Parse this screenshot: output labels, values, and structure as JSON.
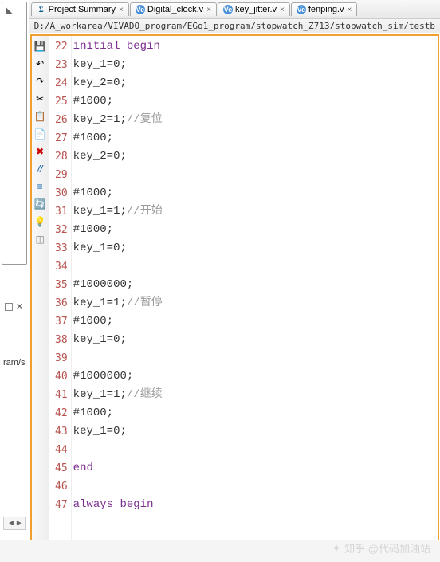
{
  "tabs": [
    {
      "icon": "Σ",
      "iconType": "sigma",
      "label": "Project Summary"
    },
    {
      "icon": "Ve",
      "iconType": "verilog",
      "label": "Digital_clock.v"
    },
    {
      "icon": "Ve",
      "iconType": "verilog",
      "label": "key_jitter.v"
    },
    {
      "icon": "Ve",
      "iconType": "verilog",
      "label": "fenping.v"
    }
  ],
  "filepath": "D:/A_workarea/VIVADO_program/EGo1_program/stopwatch_Z713/stopwatch_sim/testb",
  "left": {
    "truncText": "ram/s"
  },
  "code": {
    "start": 22,
    "lines": [
      {
        "t": "initial begin",
        "cls": "kw"
      },
      {
        "t": "key_1=0;"
      },
      {
        "t": "key_2=0;"
      },
      {
        "t": "#1000;"
      },
      {
        "t": "key_2=1;",
        "c": "//复位"
      },
      {
        "t": "#1000;"
      },
      {
        "t": "key_2=0;"
      },
      {
        "t": ""
      },
      {
        "t": "#1000;"
      },
      {
        "t": "key_1=1;",
        "c": "//开始"
      },
      {
        "t": "#1000;"
      },
      {
        "t": "key_1=0;"
      },
      {
        "t": ""
      },
      {
        "t": "#1000000;"
      },
      {
        "t": "key_1=1;",
        "c": "//暂停"
      },
      {
        "t": "#1000;"
      },
      {
        "t": "key_1=0;"
      },
      {
        "t": ""
      },
      {
        "t": "#1000000;"
      },
      {
        "t": "key_1=1;",
        "c": "//继续"
      },
      {
        "t": "#1000;"
      },
      {
        "t": "key_1=0;"
      },
      {
        "t": ""
      },
      {
        "t": "end",
        "cls": "kw"
      },
      {
        "t": ""
      },
      {
        "t": "always begin",
        "cls": "kw"
      }
    ]
  },
  "watermark": "知乎 @代码加油站"
}
